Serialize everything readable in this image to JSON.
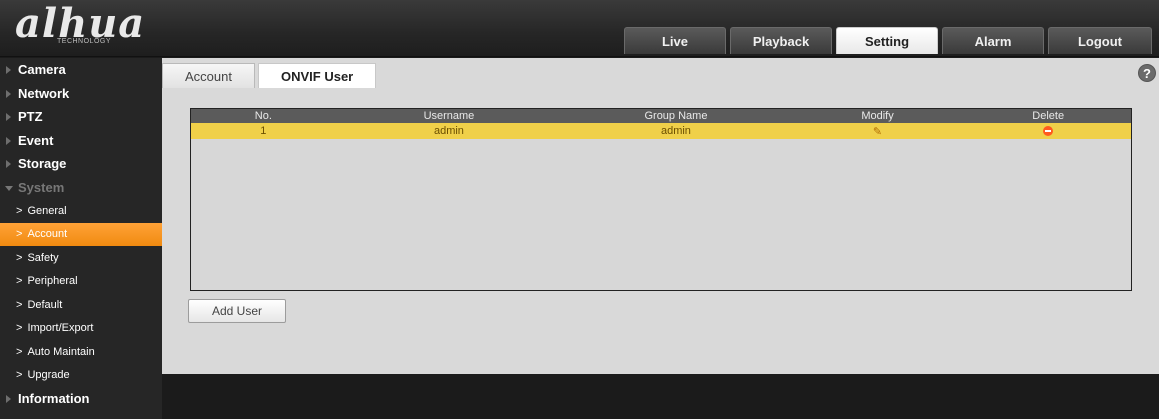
{
  "brand": {
    "logo_text": "alhua",
    "logo_sub": "TECHNOLOGY"
  },
  "nav": {
    "tabs": [
      {
        "label": "Live",
        "active": false
      },
      {
        "label": "Playback",
        "active": false
      },
      {
        "label": "Setting",
        "active": true
      },
      {
        "label": "Alarm",
        "active": false
      },
      {
        "label": "Logout",
        "active": false
      }
    ]
  },
  "sidebar": {
    "categories": [
      {
        "label": "Camera"
      },
      {
        "label": "Network"
      },
      {
        "label": "PTZ"
      },
      {
        "label": "Event"
      },
      {
        "label": "Storage"
      },
      {
        "label": "System",
        "expanded": true
      }
    ],
    "system_items": [
      {
        "label": "General"
      },
      {
        "label": "Account",
        "active": true
      },
      {
        "label": "Safety"
      },
      {
        "label": "Peripheral"
      },
      {
        "label": "Default"
      },
      {
        "label": "Import/Export"
      },
      {
        "label": "Auto Maintain"
      },
      {
        "label": "Upgrade"
      }
    ],
    "information": {
      "label": "Information"
    }
  },
  "content": {
    "tabs": [
      {
        "label": "Account",
        "active": false
      },
      {
        "label": "ONVIF User",
        "active": true
      }
    ],
    "help_glyph": "?",
    "table": {
      "headers": [
        "No.",
        "Username",
        "Group Name",
        "Modify",
        "Delete"
      ],
      "rows": [
        {
          "no": "1",
          "username": "admin",
          "group": "admin",
          "selected": true
        }
      ]
    },
    "add_user_label": "Add User"
  },
  "colors": {
    "accent_orange": "#f08a10",
    "row_selected": "#f0d049",
    "header_gray": "#5b5b5b"
  }
}
